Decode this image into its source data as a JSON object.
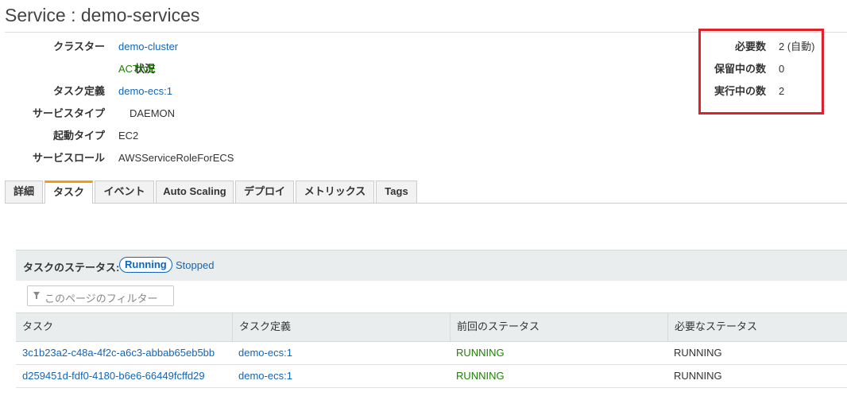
{
  "page": {
    "title": "Service : demo-services"
  },
  "details": [
    {
      "label": "クラスター",
      "value": "demo-cluster",
      "type": "link"
    },
    {
      "label": "状況",
      "value": "ACTIVE",
      "type": "status"
    },
    {
      "label": "タスク定義",
      "value": "demo-ecs:1",
      "type": "link"
    },
    {
      "label": "サービスタイプ",
      "value": "DAEMON",
      "type": "text"
    },
    {
      "label": "起動タイプ",
      "value": "EC2",
      "type": "text"
    },
    {
      "label": "サービスロール",
      "value": "AWSServiceRoleForECS",
      "type": "text"
    }
  ],
  "counts": [
    {
      "label": "必要数",
      "value": "2 (自動)"
    },
    {
      "label": "保留中の数",
      "value": "0"
    },
    {
      "label": "実行中の数",
      "value": "2"
    }
  ],
  "tabs": [
    {
      "label": "詳細",
      "active": false
    },
    {
      "label": "タスク",
      "active": true
    },
    {
      "label": "イベント",
      "active": false
    },
    {
      "label": "Auto Scaling",
      "active": false
    },
    {
      "label": "デプロイ",
      "active": false
    },
    {
      "label": "メトリックス",
      "active": false
    },
    {
      "label": "Tags",
      "active": false
    }
  ],
  "tasks": {
    "status_label": "タスクのステータス:",
    "running_label": "Running",
    "stopped_label": "Stopped",
    "filter_placeholder": "このページのフィルター",
    "columns": [
      "タスク",
      "タスク定義",
      "前回のステータス",
      "必要なステータス"
    ],
    "rows": [
      {
        "task": "3c1b23a2-c48a-4f2c-a6c3-abbab65eb5bb",
        "definition": "demo-ecs:1",
        "last_status": "RUNNING",
        "desired_status": "RUNNING"
      },
      {
        "task": "d259451d-fdf0-4180-b6e6-66449fcffd29",
        "definition": "demo-ecs:1",
        "last_status": "RUNNING",
        "desired_status": "RUNNING"
      }
    ]
  },
  "colors": {
    "link": "#1166bb",
    "status_active": "#1d8102",
    "highlight": "#e0202a",
    "active_tab": "#f39c12"
  }
}
